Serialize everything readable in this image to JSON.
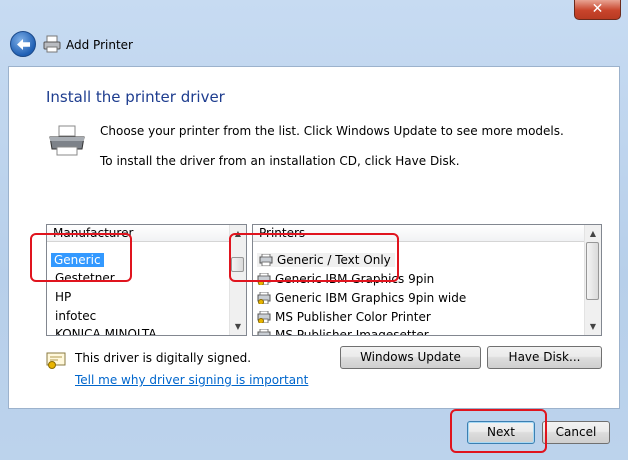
{
  "window": {
    "title": "Add Printer",
    "close_glyph": "✕"
  },
  "page": {
    "heading": "Install the printer driver",
    "instructions_1": "Choose your printer from the list. Click Windows Update to see more models.",
    "instructions_2": "To install the driver from an installation CD, click Have Disk."
  },
  "manufacturers": {
    "header": "Manufacturer",
    "items": [
      {
        "label": "Generic",
        "selected": true
      },
      {
        "label": "Gestetner"
      },
      {
        "label": "HP"
      },
      {
        "label": "infotec"
      },
      {
        "label": "KONICA MINOLTA"
      }
    ]
  },
  "printers": {
    "header": "Printers",
    "items": [
      {
        "label": "Generic / Text Only",
        "selected": true
      },
      {
        "label": "Generic IBM Graphics 9pin"
      },
      {
        "label": "Generic IBM Graphics 9pin wide"
      },
      {
        "label": "MS Publisher Color Printer"
      },
      {
        "label": "MS Publisher Imagesetter"
      }
    ]
  },
  "buttons": {
    "windows_update": "Windows Update",
    "have_disk": "Have Disk...",
    "next": "Next",
    "cancel": "Cancel"
  },
  "signing": {
    "status": "This driver is digitally signed.",
    "link": "Tell me why driver signing is important"
  },
  "colors": {
    "heading": "#1e3d8f",
    "link": "#0066cc",
    "selection": "#3399ff",
    "annotation": "#e0141e"
  }
}
